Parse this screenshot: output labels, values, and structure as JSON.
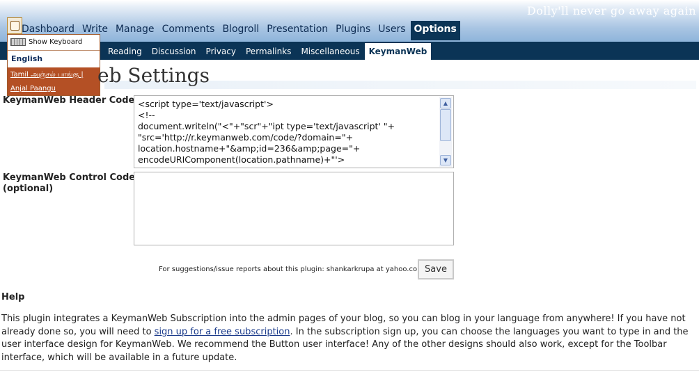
{
  "header": {
    "blog_title": "Dolly'll never go away again"
  },
  "main_nav": [
    {
      "label": "Dashboard",
      "active": false
    },
    {
      "label": "Write",
      "active": false
    },
    {
      "label": "Manage",
      "active": false
    },
    {
      "label": "Comments",
      "active": false
    },
    {
      "label": "Blogroll",
      "active": false
    },
    {
      "label": "Presentation",
      "active": false
    },
    {
      "label": "Plugins",
      "active": false
    },
    {
      "label": "Users",
      "active": false
    },
    {
      "label": "Options",
      "active": true
    }
  ],
  "sub_nav": [
    {
      "label": "Reading",
      "active": false
    },
    {
      "label": "Discussion",
      "active": false
    },
    {
      "label": "Privacy",
      "active": false
    },
    {
      "label": "Permalinks",
      "active": false
    },
    {
      "label": "Miscellaneous",
      "active": false
    },
    {
      "label": "KeymanWeb",
      "active": true
    }
  ],
  "keyboard_menu": {
    "show_label": "Show Keyboard",
    "current_language": "English",
    "languages": [
      "Tamil அஞ்சல் பாங்கு |",
      "Anjal Paangu"
    ]
  },
  "page": {
    "title": "eb Settings",
    "header_code_label": "KeymanWeb Header Code",
    "header_code_lines": [
      "<script type='text/javascript'>",
      "<!--",
      "document.writeln(\"<\"+\"scr\"+\"ipt type='text/javascript' \"+",
      "\"src='http://r.keymanweb.com/code/?domain=\"+",
      "location.hostname+\"&amp;id=236&amp;page=\"+",
      "encodeURIComponent(location.pathname)+\"'>"
    ],
    "control_code_label_1": "KeymanWeb Control Code",
    "control_code_label_2": "(optional)",
    "control_code_value": "",
    "suggestion": "For suggestions/issue reports about this plugin: shankarkrupa at yahoo.com",
    "save_label": "Save"
  },
  "help": {
    "heading": "Help",
    "text_before_link": "This plugin integrates a KeymanWeb Subscription into the admin pages of your blog, so you can blog in your language from anywhere! If you have not already done so, you will need to ",
    "link_text": "sign up for a free subscription",
    "text_after_link": ". In the subscription sign up, you can choose the languages you want to type in and the user interface design for KeymanWeb. We recommend the Button user interface! Any of the other designs should also work, except for the Toolbar interface, which will be available in a future update."
  },
  "colors": {
    "nav_dark": "#0b3456",
    "menu_brown": "#b45025",
    "header_blue": "#8eb4da"
  }
}
